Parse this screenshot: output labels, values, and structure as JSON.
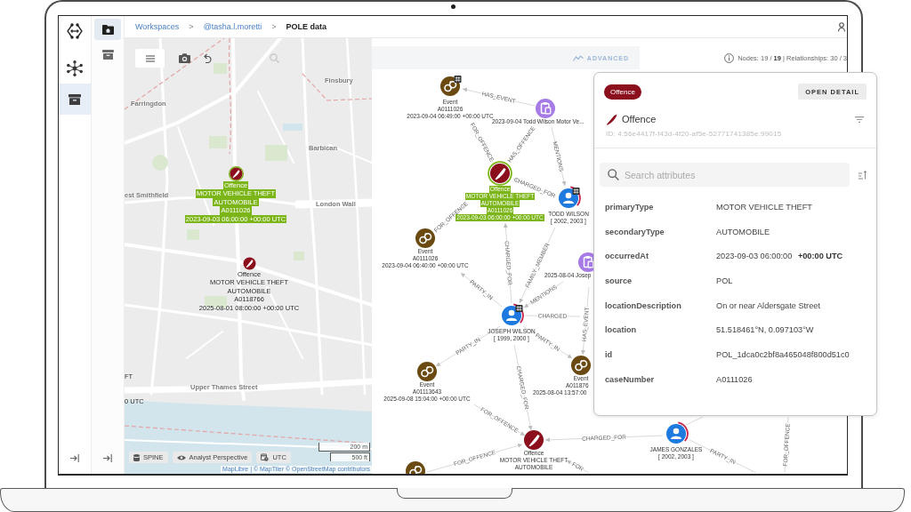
{
  "breadcrumb": [
    {
      "kind": "link",
      "label": "Workspaces"
    },
    {
      "kind": "separator",
      "label": ">"
    },
    {
      "kind": "link",
      "label": "@tasha.l.moretti"
    },
    {
      "kind": "separator",
      "label": ">"
    },
    {
      "kind": "current",
      "label": "POLE data"
    }
  ],
  "rail": [
    {
      "kind": "network",
      "selected": false
    },
    {
      "kind": "archive",
      "selected": true
    }
  ],
  "subrail": [
    {
      "kind": "home-folder",
      "selected": true
    },
    {
      "kind": "archive",
      "selected": false
    }
  ],
  "map": {
    "toolbar": [
      {
        "kind": "menu",
        "selected": true,
        "disabled": false
      },
      {
        "kind": "camera",
        "selected": false,
        "disabled": false
      },
      {
        "kind": "undo",
        "selected": false,
        "disabled": false
      },
      {
        "kind": "search",
        "selected": false,
        "disabled": true
      }
    ],
    "place_labels": [
      "Farringdon",
      "Finsbury",
      "Barbican",
      "est Smithfield",
      "London Wall",
      "Upper Thames Street"
    ],
    "markers": [
      {
        "selected": true,
        "lines": [
          "Offence",
          "MOTOR VEHICLE THEFT",
          "AUTOMOBILE",
          "A0111026",
          "2023-09-03 06:00:00 +00:00 UTC"
        ]
      },
      {
        "selected": false,
        "lines": [
          "Offence",
          "MOTOR VEHICLE THEFT",
          "AUTOMOBILE",
          "A0118766",
          "2025-08-01 08:00:00 +00:00 UTC"
        ]
      }
    ],
    "cut_labels": [
      "FT",
      "0 UTC"
    ],
    "chips": [
      {
        "kind": "spine",
        "label": "SPINE"
      },
      {
        "kind": "perspective",
        "label": "Analyst Perspective"
      },
      {
        "kind": "timezone",
        "label": "UTC"
      }
    ],
    "scale": [
      "200 m",
      "500 ft"
    ],
    "attribution": "MapLibre | © MapTiler © OpenStreetMap contributors"
  },
  "graph": {
    "advanced_button": "ADVANCED",
    "stats": "Nodes: 19 / **19** | Relationships: 30 / 3",
    "nodes": [
      {
        "kind": "event",
        "selected": false,
        "badge": true,
        "flagged": false,
        "lines": [
          "Event",
          "A0111026",
          "2023-09-04 06:49:00 +00:00 UTC"
        ]
      },
      {
        "kind": "document",
        "selected": false,
        "badge": false,
        "flagged": false,
        "lines": [
          "2023-09-04 Todd Wilson Motor Ve..."
        ]
      },
      {
        "kind": "offence",
        "selected": true,
        "badge": false,
        "flagged": false,
        "lines": [
          "Offence",
          "MOTOR VEHICLE THEFT",
          "AUTOMOBILE",
          "A0111026",
          "2023-09-03 06:00:00 +00:00 UTC"
        ]
      },
      {
        "kind": "person",
        "selected": false,
        "badge": true,
        "flagged": true,
        "lines": [
          "TODD WILSON",
          "[ 2002, 2003 ]"
        ]
      },
      {
        "kind": "event",
        "selected": false,
        "badge": false,
        "flagged": false,
        "lines": [
          "Event",
          "A0111026",
          "2023-09-04 06:40:00 +00:00 UTC"
        ]
      },
      {
        "kind": "document",
        "selected": false,
        "badge": false,
        "flagged": false,
        "lines": [
          "2025-08-04 Josep"
        ]
      },
      {
        "kind": "person",
        "selected": false,
        "badge": true,
        "flagged": true,
        "lines": [
          "JOSEPH WILSON",
          "[ 1999, 2000 ]"
        ]
      },
      {
        "kind": "event",
        "selected": false,
        "badge": false,
        "flagged": false,
        "lines": [
          "Event",
          "A01113643",
          "2025-09-08 15:04:00 +00:00 UTC"
        ]
      },
      {
        "kind": "event",
        "selected": false,
        "badge": false,
        "flagged": false,
        "lines": [
          "Event",
          "A011876",
          "2025-08-04 13:57:00"
        ]
      },
      {
        "kind": "offence",
        "selected": false,
        "badge": false,
        "flagged": false,
        "lines": [
          "Offence",
          "MOTOR VEHICLE THEFT",
          "AUTOMOBILE"
        ]
      },
      {
        "kind": "person",
        "selected": false,
        "badge": false,
        "flagged": true,
        "lines": [
          "JAMES GONZALES",
          "[ 2002, 2003 ]"
        ]
      },
      {
        "kind": "event",
        "selected": false,
        "badge": false,
        "flagged": false
      }
    ],
    "edges": [
      {
        "label": "HAS_EVENT"
      },
      {
        "label": "FOR_OFFENCE"
      },
      {
        "label": "HAS_OFFENCE"
      },
      {
        "label": "MENTIONS"
      },
      {
        "label": "CHARGED_FOR"
      },
      {
        "label": "FOR_OFFENCE"
      },
      {
        "label": "CHARGED_FOR"
      },
      {
        "label": "FAMILY_MEMBER"
      },
      {
        "label": "MENTIONS"
      },
      {
        "label": "PARTY_IN"
      },
      {
        "label": "CHARGED"
      },
      {
        "label": "HAS_EVENT"
      },
      {
        "label": "PARTY_IN"
      },
      {
        "label": "PARTY_IN"
      },
      {
        "label": "CHARGED_FOR"
      },
      {
        "label": "FOR_OFFENCE"
      },
      {
        "label": "CHARGED_FOR"
      },
      {
        "label": "FOR_OFFENCE"
      },
      {
        "label": "FOR"
      },
      {
        "label": "PARTY_IN"
      },
      {
        "label": "FOR_OFFENCE"
      }
    ]
  },
  "details": {
    "chip": "Offence",
    "open_button": "OPEN DETAIL",
    "title": "Offence",
    "id_text": "ID: 4:56e4417f-f43d-4f20-af5e-52771741385e:99015",
    "search_placeholder": "Search attributes",
    "attributes": [
      {
        "name": "primaryType",
        "value": "MOTOR VEHICLE THEFT"
      },
      {
        "name": "secondaryType",
        "value": "AUTOMOBILE"
      },
      {
        "name": "occurredAt",
        "value": "2023-09-03 06:00:00 **+00:00 UTC**"
      },
      {
        "name": "source",
        "value": "POL"
      },
      {
        "name": "locationDescription",
        "value": "On or near Aldersgate Street"
      },
      {
        "name": "location",
        "value": "51.518461°N, 0.097103°W"
      },
      {
        "name": "id",
        "value": "POL_1dca0c2bf8a465048f800d51c0"
      },
      {
        "name": "caseNumber",
        "value": "A0111026"
      }
    ]
  }
}
